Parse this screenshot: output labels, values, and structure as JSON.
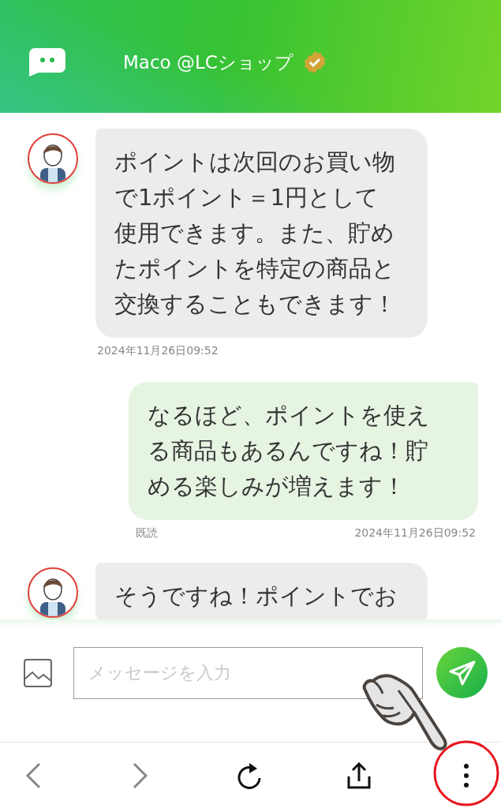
{
  "header": {
    "title": "Maco @LCショップ",
    "verified": true
  },
  "messages": [
    {
      "kind": "received",
      "text": "ポイントは次回のお買い物で1ポイント＝1円として使用できます。また、貯めたポイントを特定の商品と交換することもできます！",
      "time": "2024年11月26日09:52"
    },
    {
      "kind": "sent",
      "text": "なるほど、ポイントを使える商品もあるんですね！貯める楽しみが増えます！",
      "read_label": "既読",
      "time": "2024年11月26日09:52"
    },
    {
      "kind": "received_partial",
      "text": "そうですね！ポイントでお"
    }
  ],
  "composer": {
    "placeholder": "メッセージを入力"
  }
}
